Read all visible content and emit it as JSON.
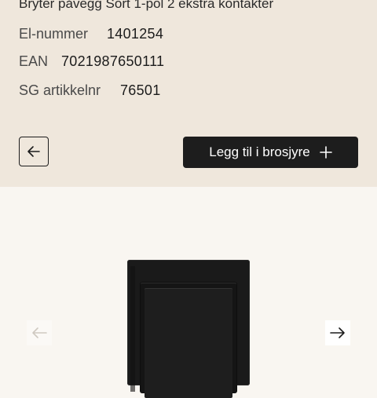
{
  "product": {
    "title": "Bryter påvegg Sort 1-pol 2 ekstra kontakter",
    "specs": [
      {
        "label": "El-nummer",
        "value": "1401254"
      },
      {
        "label": "EAN",
        "value": "7021987650111"
      },
      {
        "label": "SG artikkelnr",
        "value": "76501"
      }
    ]
  },
  "actions": {
    "back_icon": "arrow-left-icon",
    "add_to_brochure_label": "Legg til i brosjyre",
    "add_icon": "plus-icon"
  },
  "gallery": {
    "prev_icon": "arrow-left-icon",
    "next_icon": "arrow-right-icon",
    "image": "black-wall-switch"
  },
  "colors": {
    "panel_bg": "#efe7dc",
    "page_bg": "#f9f6f1",
    "button_dark": "#1d1d1d"
  }
}
